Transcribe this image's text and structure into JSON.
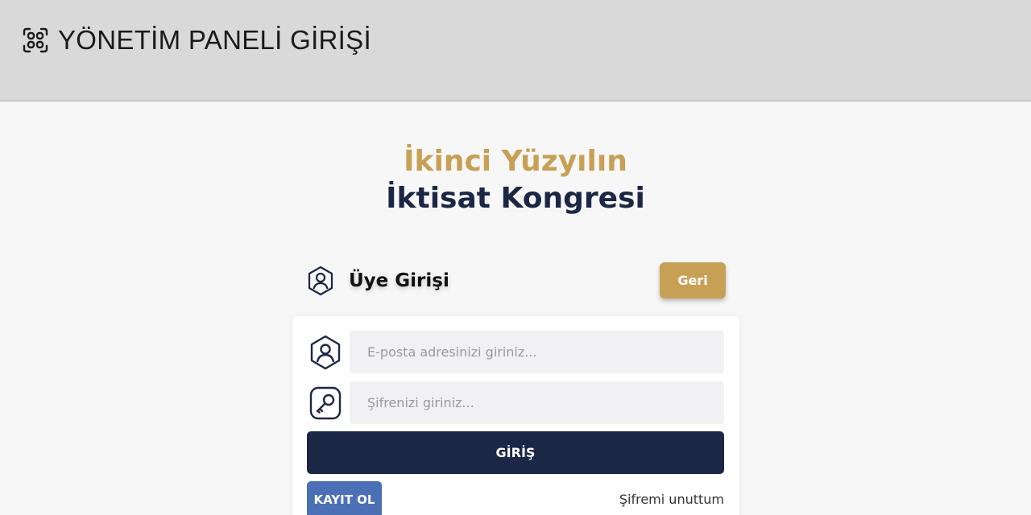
{
  "header": {
    "title": "YÖNETİM PANELİ GİRİŞİ",
    "logo_icon": "qr-grid-icon"
  },
  "hero": {
    "line1": "İkinci Yüzyılın",
    "line2": "İktisat Kongresi"
  },
  "login": {
    "section_title": "Üye Girişi",
    "section_icon": "user-hexagon-icon",
    "back_label": "Geri",
    "email": {
      "placeholder": "E-posta adresinizi giriniz...",
      "value": "",
      "icon": "user-hexagon-icon"
    },
    "password": {
      "placeholder": "Şifrenizi giriniz...",
      "value": "",
      "icon": "key-icon"
    },
    "submit_label": "GİRİŞ",
    "register_label": "KAYIT OL",
    "forgot_label": "Şifremi unuttum"
  },
  "colors": {
    "gold": "#c8a055",
    "navy": "#1b2745",
    "blue": "#4b70b5",
    "header_bg": "#d9d9da"
  }
}
